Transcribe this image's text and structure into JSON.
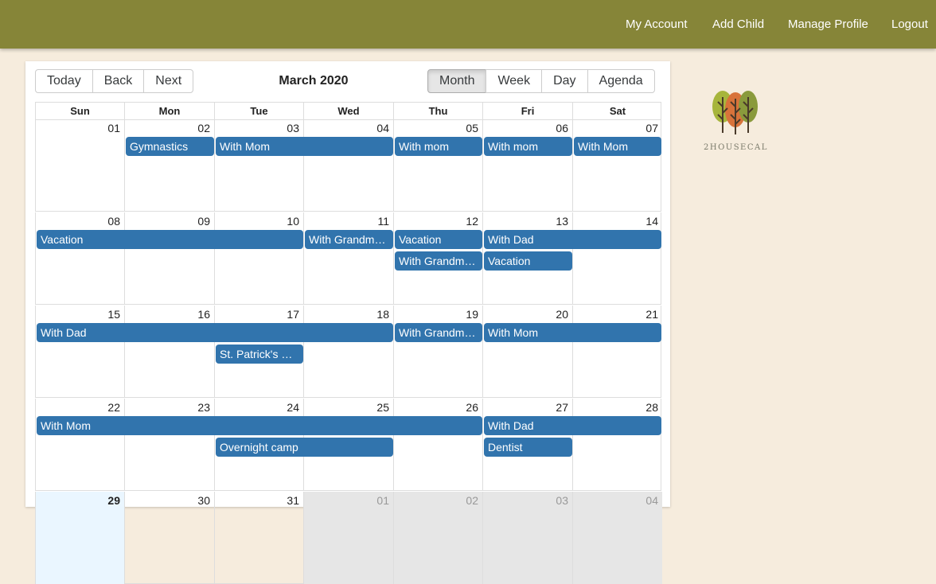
{
  "nav": {
    "my_account": "My Account",
    "add_child": "Add Child",
    "manage_profile": "Manage Profile",
    "logout": "Logout"
  },
  "toolbar": {
    "today": "Today",
    "back": "Back",
    "next": "Next",
    "title": "March 2020",
    "views": [
      "Month",
      "Week",
      "Day",
      "Agenda"
    ],
    "active_view": "Month"
  },
  "weekdays": [
    "Sun",
    "Mon",
    "Tue",
    "Wed",
    "Thu",
    "Fri",
    "Sat"
  ],
  "weeks": [
    {
      "days": [
        "01",
        "02",
        "03",
        "04",
        "05",
        "06",
        "07"
      ],
      "off": [],
      "today": -1,
      "events": [
        {
          "label": "Gymnastics",
          "start": 1,
          "span": 1,
          "row": 0
        },
        {
          "label": "With Mom",
          "start": 2,
          "span": 2,
          "row": 0
        },
        {
          "label": "With mom",
          "start": 4,
          "span": 1,
          "row": 0
        },
        {
          "label": "With mom",
          "start": 5,
          "span": 1,
          "row": 0
        },
        {
          "label": "With Mom",
          "start": 6,
          "span": 1,
          "row": 0
        }
      ]
    },
    {
      "days": [
        "08",
        "09",
        "10",
        "11",
        "12",
        "13",
        "14"
      ],
      "off": [],
      "today": -1,
      "events": [
        {
          "label": "Vacation",
          "start": 0,
          "span": 3,
          "row": 0
        },
        {
          "label": "With Grandm…",
          "start": 3,
          "span": 1,
          "row": 0
        },
        {
          "label": "Vacation",
          "start": 4,
          "span": 1,
          "row": 0
        },
        {
          "label": "With Dad",
          "start": 5,
          "span": 2,
          "row": 0
        },
        {
          "label": "With Grandm…",
          "start": 4,
          "span": 1,
          "row": 1
        },
        {
          "label": "Vacation",
          "start": 5,
          "span": 1,
          "row": 1
        }
      ]
    },
    {
      "days": [
        "15",
        "16",
        "17",
        "18",
        "19",
        "20",
        "21"
      ],
      "off": [],
      "today": -1,
      "events": [
        {
          "label": "With Dad",
          "start": 0,
          "span": 4,
          "row": 0
        },
        {
          "label": "With Grandm…",
          "start": 4,
          "span": 1,
          "row": 0
        },
        {
          "label": "With Mom",
          "start": 5,
          "span": 2,
          "row": 0
        },
        {
          "label": "St. Patrick's …",
          "start": 2,
          "span": 1,
          "row": 1
        }
      ]
    },
    {
      "days": [
        "22",
        "23",
        "24",
        "25",
        "26",
        "27",
        "28"
      ],
      "off": [],
      "today": -1,
      "events": [
        {
          "label": "With Mom",
          "start": 0,
          "span": 5,
          "row": 0
        },
        {
          "label": "With Dad",
          "start": 5,
          "span": 2,
          "row": 0
        },
        {
          "label": "Overnight camp",
          "start": 2,
          "span": 2,
          "row": 1
        },
        {
          "label": "Dentist",
          "start": 5,
          "span": 1,
          "row": 1
        }
      ]
    },
    {
      "days": [
        "29",
        "30",
        "31",
        "01",
        "02",
        "03",
        "04"
      ],
      "off": [
        3,
        4,
        5,
        6
      ],
      "today": 0,
      "events": []
    }
  ],
  "logo": {
    "text": "2HOUSECAL"
  }
}
